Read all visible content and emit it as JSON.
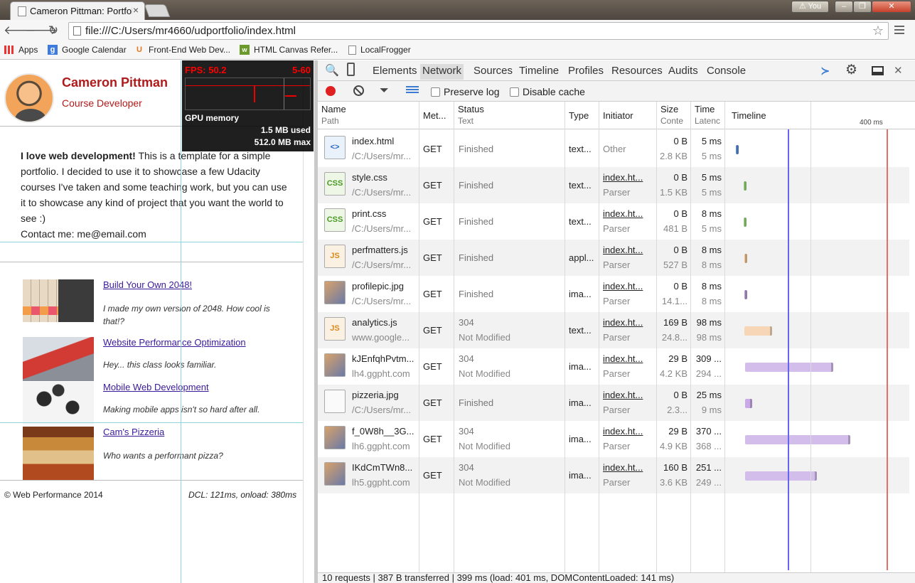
{
  "browser": {
    "tab_title": "Cameron Pittman: Portfol",
    "user_label": "You",
    "url": "file:///C:/Users/mr4660/udportfolio/index.html",
    "bookmarks": [
      {
        "label": "Apps",
        "icon": "apps-grid-icon"
      },
      {
        "label": "Google Calendar",
        "icon": "google-calendar-icon"
      },
      {
        "label": "Front-End Web Dev...",
        "icon": "udacity-icon"
      },
      {
        "label": "HTML Canvas Refer...",
        "icon": "w3-icon"
      },
      {
        "label": "LocalFrogger",
        "icon": "page-icon"
      }
    ]
  },
  "page": {
    "name": "Cameron Pittman",
    "role": "Course Developer",
    "about_bold": "I love web development!",
    "about_text": " This is a template for a simple portfolio. I decided to use it to showcase a few Udacity courses I've taken and some teaching work, but you can use it to showcase any kind of project that you want the world to see :)",
    "contact": "Contact me: me@email.com",
    "projects": [
      {
        "title": "Build Your Own 2048!",
        "desc": "I made my own version of 2048. How cool is that!?"
      },
      {
        "title": "Website Performance Optimization",
        "desc": "Hey... this class looks familiar."
      },
      {
        "title": "Mobile Web Development",
        "desc": "Making mobile apps isn't so hard after all."
      },
      {
        "title": "Cam's Pizzeria",
        "desc": "Who wants a performant pizza?"
      }
    ],
    "footer_left": "© Web Performance 2014",
    "footer_right": "DCL: 121ms, onload: 380ms"
  },
  "fps_meter": {
    "fps": "FPS: 50.2",
    "range": "5-60",
    "gpu_label": "GPU memory",
    "used": "1.5 MB used",
    "max": "512.0 MB max"
  },
  "devtools": {
    "tabs": [
      "Elements",
      "Network",
      "Sources",
      "Timeline",
      "Profiles",
      "Resources",
      "Audits",
      "Console"
    ],
    "active_tab": "Network",
    "preserve_log": "Preserve log",
    "disable_cache": "Disable cache",
    "columns": {
      "name": "Name",
      "name_sub": "Path",
      "method": "Met...",
      "status": "Status",
      "status_sub": "Text",
      "type": "Type",
      "initiator": "Initiator",
      "size": "Size",
      "size_sub": "Conte",
      "time": "Time",
      "time_sub": "Latenc",
      "timeline": "Timeline",
      "timeline_tick": "400 ms"
    },
    "requests": [
      {
        "name": "index.html",
        "path": "/C:/Users/mr...",
        "method": "GET",
        "status": "Finished",
        "status_text": "",
        "type": "text...",
        "initiator": "Other",
        "initiator_sub": "",
        "size": "0 B",
        "content": "2.8 KB",
        "time": "5 ms",
        "latency": "5 ms",
        "icon": "html",
        "bar_color": "#5b8de0",
        "bar_start_ms": 0,
        "bar_end_ms": 5
      },
      {
        "name": "style.css",
        "path": "/C:/Users/mr...",
        "method": "GET",
        "status": "Finished",
        "status_text": "",
        "type": "text...",
        "initiator": "index.ht...",
        "initiator_sub": "Parser",
        "size": "0 B",
        "content": "1.5 KB",
        "time": "5 ms",
        "latency": "5 ms",
        "icon": "css",
        "bar_color": "#9dd27e",
        "bar_start_ms": 28,
        "bar_end_ms": 33
      },
      {
        "name": "print.css",
        "path": "/C:/Users/mr...",
        "method": "GET",
        "status": "Finished",
        "status_text": "",
        "type": "text...",
        "initiator": "index.ht...",
        "initiator_sub": "Parser",
        "size": "0 B",
        "content": "481 B",
        "time": "8 ms",
        "latency": "5 ms",
        "icon": "css",
        "bar_color": "#9dd27e",
        "bar_start_ms": 28,
        "bar_end_ms": 36
      },
      {
        "name": "perfmatters.js",
        "path": "/C:/Users/mr...",
        "method": "GET",
        "status": "Finished",
        "status_text": "",
        "type": "appl...",
        "initiator": "index.ht...",
        "initiator_sub": "Parser",
        "size": "0 B",
        "content": "527 B",
        "time": "8 ms",
        "latency": "8 ms",
        "icon": "js",
        "bar_color": "#f4c08f",
        "bar_start_ms": 30,
        "bar_end_ms": 38
      },
      {
        "name": "profilepic.jpg",
        "path": "/C:/Users/mr...",
        "method": "GET",
        "status": "Finished",
        "status_text": "",
        "type": "ima...",
        "initiator": "index.ht...",
        "initiator_sub": "Parser",
        "size": "0 B",
        "content": "14.1...",
        "time": "8 ms",
        "latency": "8 ms",
        "icon": "img",
        "bar_color": "#b99bdc",
        "bar_start_ms": 30,
        "bar_end_ms": 38
      },
      {
        "name": "analytics.js",
        "path": "www.google...",
        "method": "GET",
        "status": "304",
        "status_text": "Not Modified",
        "type": "text...",
        "initiator": "index.ht...",
        "initiator_sub": "Parser",
        "size": "169 B",
        "content": "24.8...",
        "time": "98 ms",
        "latency": "98 ms",
        "icon": "js",
        "bar_color": "#f6d6b6",
        "bar_start_ms": 30,
        "bar_end_ms": 128
      },
      {
        "name": "kJEnfqhPvtm...",
        "path": "lh4.ggpht.com",
        "method": "GET",
        "status": "304",
        "status_text": "Not Modified",
        "type": "ima...",
        "initiator": "index.ht...",
        "initiator_sub": "Parser",
        "size": "29 B",
        "content": "4.2 KB",
        "time": "309 ...",
        "latency": "294 ...",
        "icon": "img",
        "bar_color": "#d3bdea",
        "bar_start_ms": 32,
        "bar_end_ms": 341
      },
      {
        "name": "pizzeria.jpg",
        "path": "/C:/Users/mr...",
        "method": "GET",
        "status": "Finished",
        "status_text": "",
        "type": "ima...",
        "initiator": "index.ht...",
        "initiator_sub": "Parser",
        "size": "0 B",
        "content": "2.3...",
        "time": "25 ms",
        "latency": "9 ms",
        "icon": "blank",
        "bar_color": "#c9a9e6",
        "bar_start_ms": 32,
        "bar_end_ms": 57
      },
      {
        "name": "f_0W8h__3G...",
        "path": "lh6.ggpht.com",
        "method": "GET",
        "status": "304",
        "status_text": "Not Modified",
        "type": "ima...",
        "initiator": "index.ht...",
        "initiator_sub": "Parser",
        "size": "29 B",
        "content": "4.9 KB",
        "time": "370 ...",
        "latency": "368 ...",
        "icon": "img",
        "bar_color": "#d3bdea",
        "bar_start_ms": 32,
        "bar_end_ms": 402
      },
      {
        "name": "IKdCmTWn8...",
        "path": "lh5.ggpht.com",
        "method": "GET",
        "status": "304",
        "status_text": "Not Modified",
        "type": "ima...",
        "initiator": "index.ht...",
        "initiator_sub": "Parser",
        "size": "160 B",
        "content": "3.6 KB",
        "time": "251 ...",
        "latency": "249 ...",
        "icon": "img",
        "bar_color": "#d3bdea",
        "bar_start_ms": 32,
        "bar_end_ms": 283
      }
    ],
    "timeline_markers_ms": {
      "domcontentloaded": 141,
      "load": 401
    },
    "status_bar": "10 requests | 387 B transferred | 399 ms (load: 401 ms, DOMContentLoaded: 141 ms)"
  }
}
